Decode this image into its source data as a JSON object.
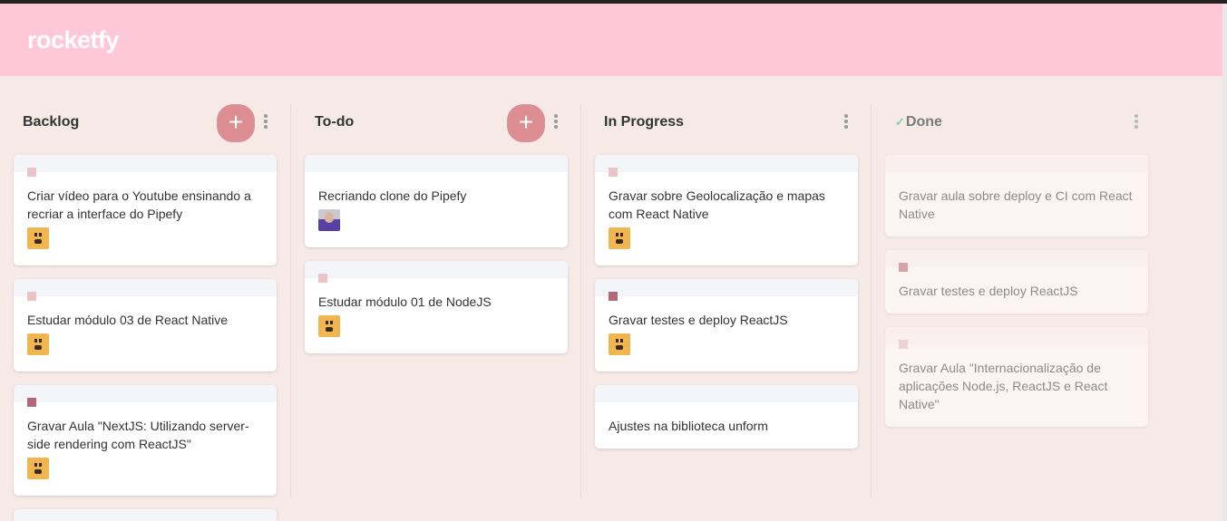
{
  "app": {
    "title": "rocketfy"
  },
  "lists": [
    {
      "title": "Backlog",
      "creatable": true,
      "cards": [
        {
          "content": "Criar vídeo para o Youtube ensinando a recriar a interface do Pipefy",
          "label": "#ebc3c6",
          "avatar": "yellow-avatar"
        },
        {
          "content": "Estudar módulo 03 de React Native",
          "label": "#ebc3c6",
          "avatar": "yellow-avatar"
        },
        {
          "content": "Gravar Aula \"NextJS: Utilizando server-side rendering com ReactJS\"",
          "label": "#b46877",
          "avatar": "yellow-avatar"
        }
      ]
    },
    {
      "title": "To-do",
      "creatable": true,
      "cards": [
        {
          "content": "Recriando clone do Pipefy",
          "label": null,
          "avatar": "photo-avatar"
        },
        {
          "content": "Estudar módulo 01 de NodeJS",
          "label": "#ebc3c6",
          "avatar": "yellow-avatar"
        }
      ]
    },
    {
      "title": "In Progress",
      "creatable": false,
      "cards": [
        {
          "content": "Gravar sobre Geolocalização e mapas com React Native",
          "label": "#ebc3c6",
          "avatar": "yellow-avatar"
        },
        {
          "content": "Gravar testes e deploy ReactJS",
          "label": "#b46877",
          "avatar": "yellow-avatar"
        },
        {
          "content": "Ajustes na biblioteca unform",
          "label": null,
          "avatar": null
        }
      ]
    },
    {
      "title": "Done",
      "creatable": false,
      "done": true,
      "title_icon": "check-icon",
      "cards": [
        {
          "content": "Gravar aula sobre deploy e CI com React Native",
          "label": null,
          "avatar": null
        },
        {
          "content": "Gravar testes e deploy ReactJS",
          "label": "#d4a3aa",
          "avatar": null
        },
        {
          "content": "Gravar Aula \"Internacionalização de aplicações Node.js, ReactJS e React Native\"",
          "label": "#f0d1d3",
          "avatar": null
        }
      ]
    }
  ],
  "icons": {
    "add": "+",
    "check": "✓"
  },
  "colors": {
    "header": "#ffc8d8",
    "background": "#f5eae6",
    "add_button": "#dd8e92"
  }
}
